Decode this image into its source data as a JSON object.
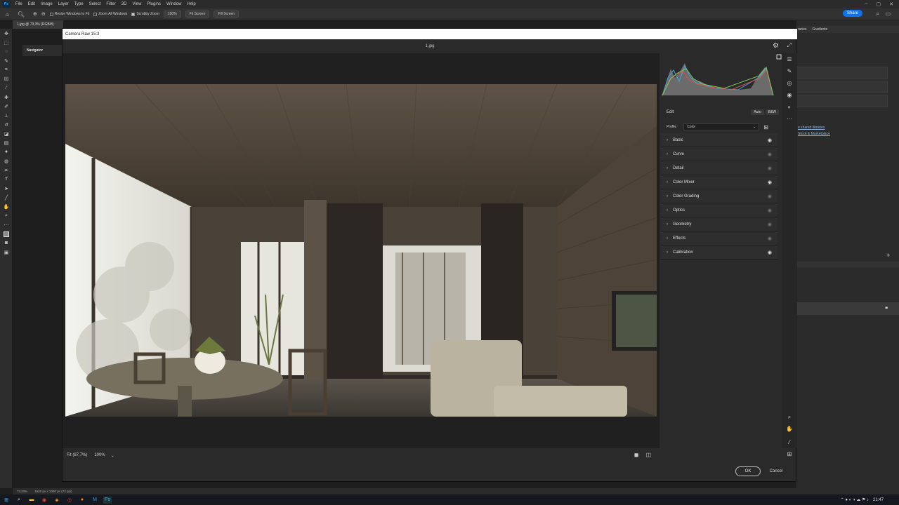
{
  "menubar": {
    "items": [
      "File",
      "Edit",
      "Image",
      "Layer",
      "Type",
      "Select",
      "Filter",
      "3D",
      "View",
      "Plugins",
      "Window",
      "Help"
    ]
  },
  "optbar": {
    "resize_windows": "Resize Windows to Fit",
    "zoom_all": "Zoom All Windows",
    "scrubby_zoom": "Scrubby Zoom",
    "zoom_100": "100%",
    "fit_screen": "Fit Screen",
    "fill_screen": "Fill Screen",
    "share": "Share"
  },
  "doc_tab": "1.jpg @ 73,3% (RGB/8)",
  "navigator": "Navigator",
  "right_panel": {
    "tab_libraries": "raries",
    "tab_gradients": "Gradients",
    "link1": "e shared libraries",
    "link2": "Stock & Marketplace"
  },
  "statusbar": {
    "zoom": "73,33%",
    "doc_info": "1920 px x 1080 px (72 ppi)"
  },
  "taskbar": {
    "time": "21:47"
  },
  "camera_raw": {
    "title": "Camera Raw 15.3",
    "filename": "1.jpg",
    "fit_label": "Fit (87,7%)",
    "zoom_value": "100%",
    "edit_label": "Edit",
    "auto_label": "Auto",
    "bw_label": "B&W",
    "profile_label": "Profile",
    "profile_value": "Color",
    "sections": [
      {
        "label": "Basic",
        "visible": true
      },
      {
        "label": "Curve",
        "visible": false
      },
      {
        "label": "Detail",
        "visible": false
      },
      {
        "label": "Color Mixer",
        "visible": true
      },
      {
        "label": "Color Grading",
        "visible": false
      },
      {
        "label": "Optics",
        "visible": false
      },
      {
        "label": "Geometry",
        "visible": false
      },
      {
        "label": "Effects",
        "visible": false
      },
      {
        "label": "Calibration",
        "visible": true
      }
    ],
    "ok_label": "OK",
    "cancel_label": "Cancel"
  }
}
